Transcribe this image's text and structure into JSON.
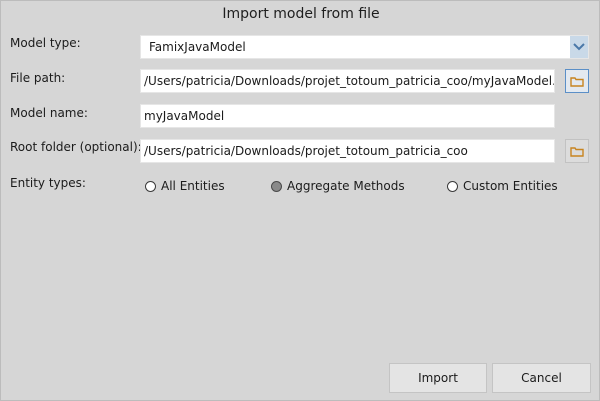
{
  "window": {
    "title": "Import model from file"
  },
  "model_type": {
    "label": "Model type:",
    "selected": "FamixJavaModel"
  },
  "file_path": {
    "label": "File path:",
    "value": "/Users/patricia/Downloads/projet_totoum_patricia_coo/myJavaModel.mse"
  },
  "model_name": {
    "label": "Model name:",
    "value": "myJavaModel"
  },
  "root_folder": {
    "label": "Root folder (optional):",
    "value": "/Users/patricia/Downloads/projet_totoum_patricia_coo"
  },
  "entity_types": {
    "label": "Entity types:",
    "options": [
      {
        "label": "All Entities",
        "checked": false
      },
      {
        "label": "Aggregate Methods",
        "checked": true
      },
      {
        "label": "Custom Entities",
        "checked": false
      }
    ]
  },
  "buttons": {
    "import_label": "Import",
    "cancel_label": "Cancel"
  },
  "colors": {
    "background": "#d6d6d6",
    "accent": "#5b8fc7",
    "folder_icon": "#c8841f"
  }
}
